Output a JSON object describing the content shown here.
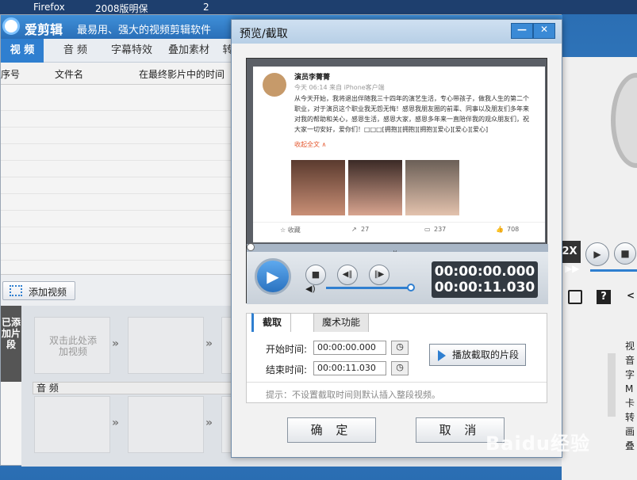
{
  "taskbar": {
    "item1": "Firefox",
    "item2": "2008版明保",
    "item3": "2"
  },
  "app": {
    "name": "爱剪辑",
    "slogan": "最易用、强大的视频剪辑软件",
    "tabs": [
      "视  频",
      "音  频",
      "字幕特效",
      "叠加素材",
      "转"
    ],
    "columns": {
      "index": "序号",
      "filename": "文件名",
      "time": "在最终影片中的时间"
    },
    "add_video": "添加视频",
    "added_clips_label": "已添加片段",
    "slot_hint": "双击此处添加视频",
    "audio_label": "音  频",
    "speed_label": "2X",
    "side_chars": [
      "视",
      "音",
      "字",
      "M",
      "卡",
      "转",
      "画",
      "叠"
    ]
  },
  "dialog": {
    "title": "预览/截取",
    "min_label": "—",
    "close_label": "✕",
    "post": {
      "username": "演员李菁菁",
      "meta": "今天 06:14 来自 iPhone客户端",
      "text": "从今天开始，我将退出伴随我三十四年的演艺生活，专心带孩子，做我人生的第二个职业，对于演员这个职业我无怨无悔！感恩我朋友圈的前辈、同事以及朋友们多年来对我的帮助和关心，感恩生活，感恩大家，感恩多年来一直陪伴我的观众朋友们，祝大家一切安好，爱你们！□□□[拥抱][拥抱][拥抱][爱心][爱心][爱心]",
      "collapse": "收起全文 ∧",
      "fav": "☆ 收藏",
      "share": "27",
      "comment": "237",
      "like": "708"
    },
    "time_current": "00:00:00.000",
    "time_total": "00:00:11.030",
    "tabs": {
      "cut": "截取",
      "magic": "魔术功能"
    },
    "start_label": "开始时间:",
    "end_label": "结束时间:",
    "start_value": "00:00:00.000",
    "end_value": "00:00:11.030",
    "play_segment": "播放截取的片段",
    "hint": "提示：不设置截取时间则默认插入整段视频。",
    "confirm": "确 定",
    "cancel": "取 消"
  },
  "watermark": "Baidu经验"
}
